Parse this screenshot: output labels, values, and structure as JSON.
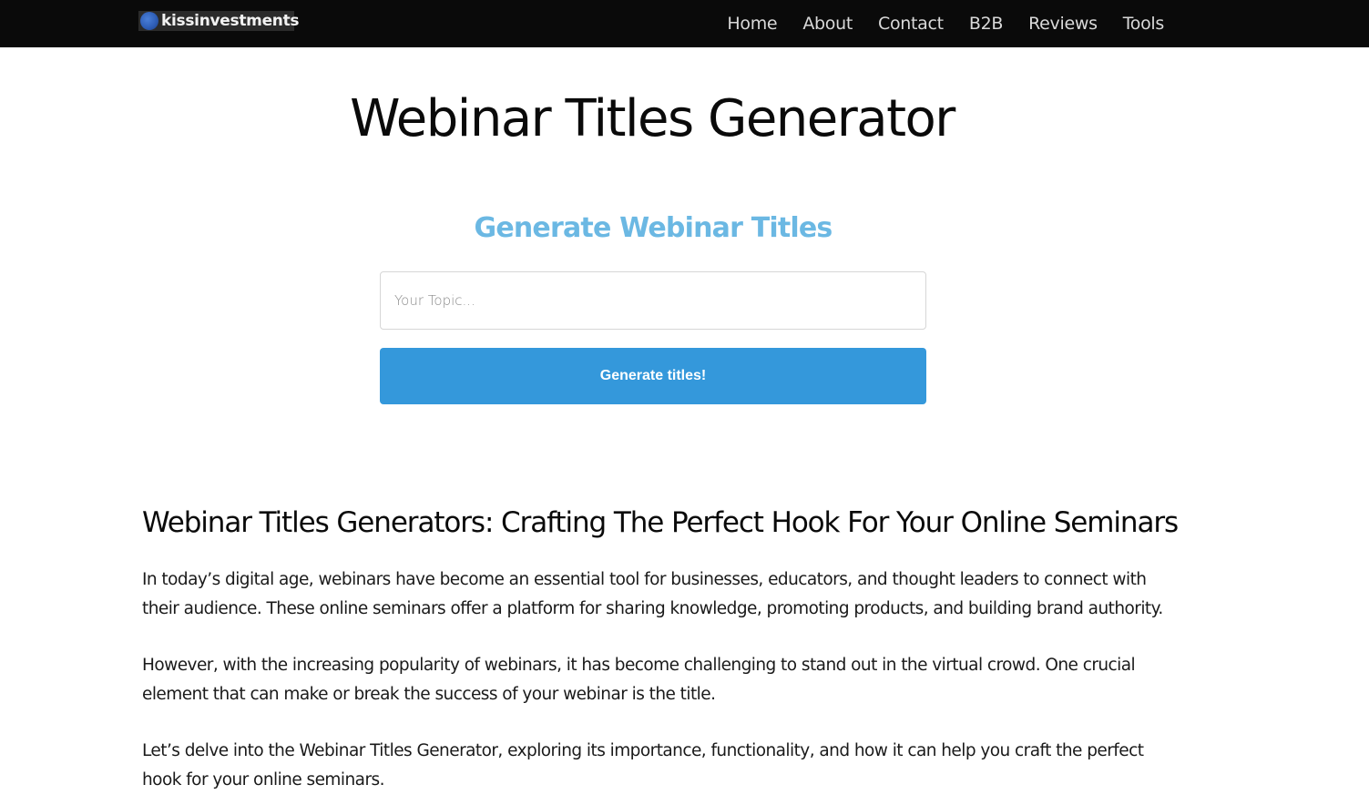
{
  "header": {
    "logo": {
      "icon": "globe-icon",
      "text": "kissinvestments"
    },
    "nav": [
      {
        "label": "Home"
      },
      {
        "label": "About"
      },
      {
        "label": "Contact"
      },
      {
        "label": "B2B"
      },
      {
        "label": "Reviews"
      },
      {
        "label": "Tools"
      }
    ]
  },
  "page": {
    "title": "Webinar Titles Generator"
  },
  "tool": {
    "heading": "Generate Webinar Titles",
    "topic_input": {
      "value": "",
      "placeholder": "Your Topic..."
    },
    "generate_label": "Generate titles!"
  },
  "article": {
    "heading": "Webinar Titles Generators: Crafting The Perfect Hook For Your Online Seminars",
    "paragraphs": [
      "In today’s digital age, webinars have become an essential tool for businesses, educators, and thought leaders to connect with their audience. These online seminars offer a platform for sharing knowledge, promoting products, and building brand authority.",
      "However, with the increasing popularity of webinars, it has become challenging to stand out in the virtual crowd. One crucial element that can make or break the success of your webinar is the title.",
      "Let’s delve into the Webinar Titles Generator, exploring its importance, functionality, and how it can help you craft the perfect hook for your online seminars."
    ]
  },
  "colors": {
    "header_bg": "#0a0a0a",
    "accent_heading": "#6bb8e3",
    "button_bg": "#3498db"
  }
}
